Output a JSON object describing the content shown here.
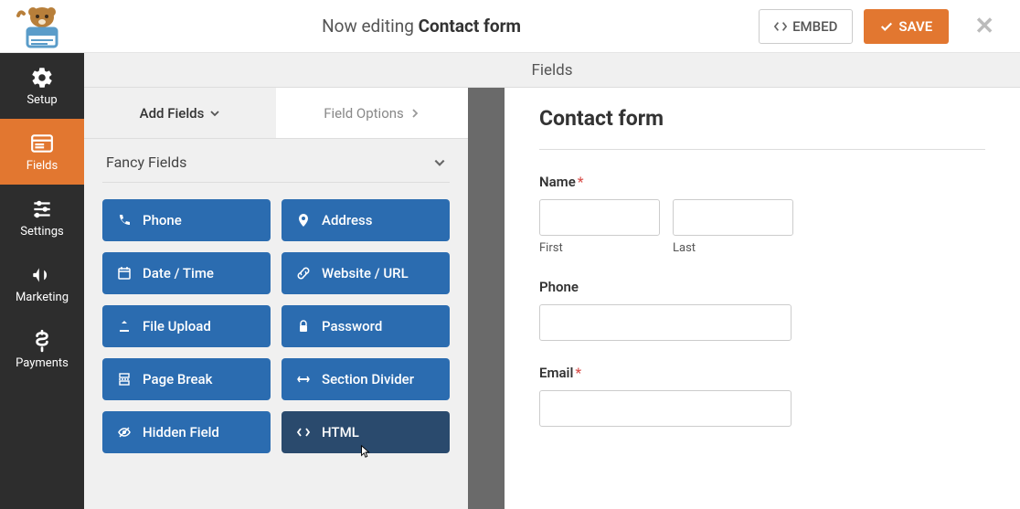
{
  "header": {
    "editing_prefix": "Now editing",
    "form_name": "Contact form",
    "embed_label": "EMBED",
    "save_label": "SAVE"
  },
  "sidebar": {
    "items": [
      {
        "label": "Setup"
      },
      {
        "label": "Fields"
      },
      {
        "label": "Settings"
      },
      {
        "label": "Marketing"
      },
      {
        "label": "Payments"
      }
    ]
  },
  "section_title": "Fields",
  "tabs": {
    "add_fields": "Add Fields",
    "field_options": "Field Options"
  },
  "group_title": "Fancy Fields",
  "fields": [
    {
      "label": "Phone"
    },
    {
      "label": "Address"
    },
    {
      "label": "Date / Time"
    },
    {
      "label": "Website / URL"
    },
    {
      "label": "File Upload"
    },
    {
      "label": "Password"
    },
    {
      "label": "Page Break"
    },
    {
      "label": "Section Divider"
    },
    {
      "label": "Hidden Field"
    },
    {
      "label": "HTML"
    }
  ],
  "preview": {
    "title": "Contact form",
    "name_label": "Name",
    "first_label": "First",
    "last_label": "Last",
    "phone_label": "Phone",
    "email_label": "Email"
  }
}
